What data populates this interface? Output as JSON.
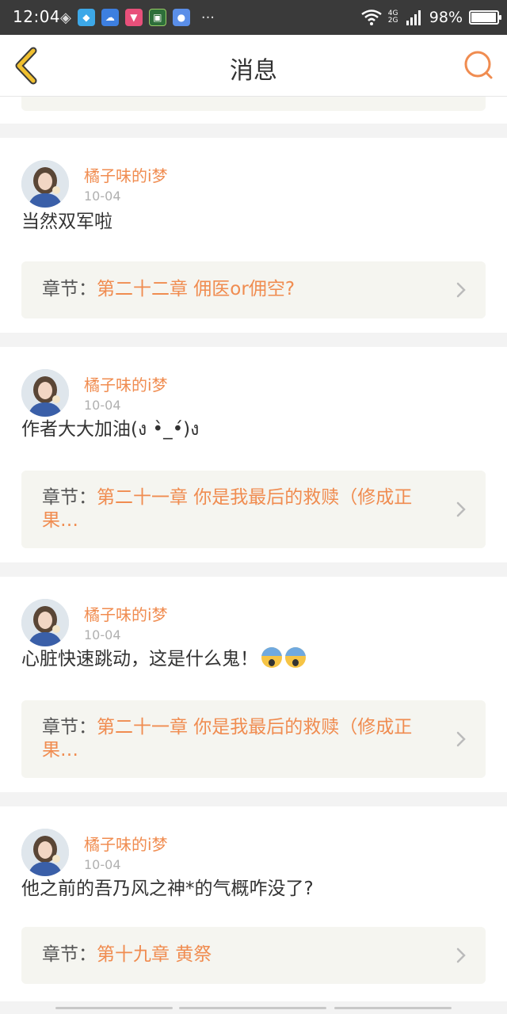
{
  "status": {
    "time": "12:04",
    "net": "4G 2G",
    "battery": "98%",
    "battery_level": 0.98,
    "more": "···"
  },
  "nav": {
    "title": "消息"
  },
  "comments": [
    {
      "user": "橘子味的i梦",
      "date": "10-04",
      "text": "当然双军啦",
      "chapter_label": "章节：",
      "chapter_title": "第二十二章 佣医or佣空?"
    },
    {
      "user": "橘子味的i梦",
      "date": "10-04",
      "text": "作者大大加油(ง •̀_•́)ง",
      "chapter_label": "章节：",
      "chapter_title": "第二十一章 你是我最后的救赎（修成正果…"
    },
    {
      "user": "橘子味的i梦",
      "date": "10-04",
      "text": "心脏快速跳动，这是什么鬼！",
      "emoji_count": 2,
      "emoji": "screaming-face",
      "chapter_label": "章节：",
      "chapter_title": "第二十一章 你是我最后的救赎（修成正果…"
    },
    {
      "user": "橘子味的i梦",
      "date": "10-04",
      "text": "他之前的吾乃风之神*的气概咋没了?",
      "chapter_label": "章节：",
      "chapter_title": "第十九章 黄祭"
    }
  ],
  "colors": {
    "accent": "#f08c50",
    "back_arrow": "#f0c030",
    "status_bg": "#3a3a3a"
  }
}
